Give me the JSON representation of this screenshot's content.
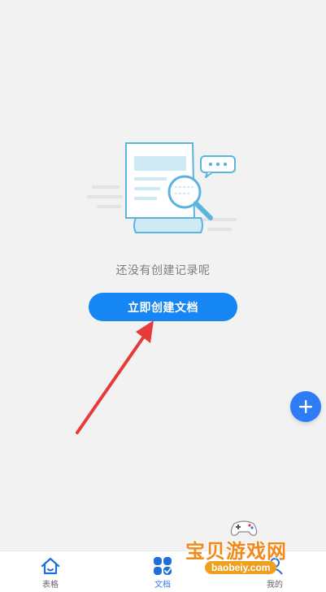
{
  "empty_state": {
    "message": "还没有创建记录呢",
    "cta_label": "立即创建文档"
  },
  "fab": {
    "icon": "plus-icon"
  },
  "bottom_nav": {
    "items": [
      {
        "label": "表格",
        "icon": "home-icon",
        "active": false
      },
      {
        "label": "文档",
        "icon": "grid-check-icon",
        "active": true
      },
      {
        "label": "我的",
        "icon": "user-icon",
        "active": false
      }
    ]
  },
  "watermark": {
    "title": "宝贝游戏网",
    "url": "baobeiy.com"
  },
  "colors": {
    "background": "#f2f2f2",
    "primary": "#1786f5",
    "fab": "#2f7df6",
    "annotation_arrow": "#e53b3b",
    "watermark_orange": "#f08a1a"
  }
}
